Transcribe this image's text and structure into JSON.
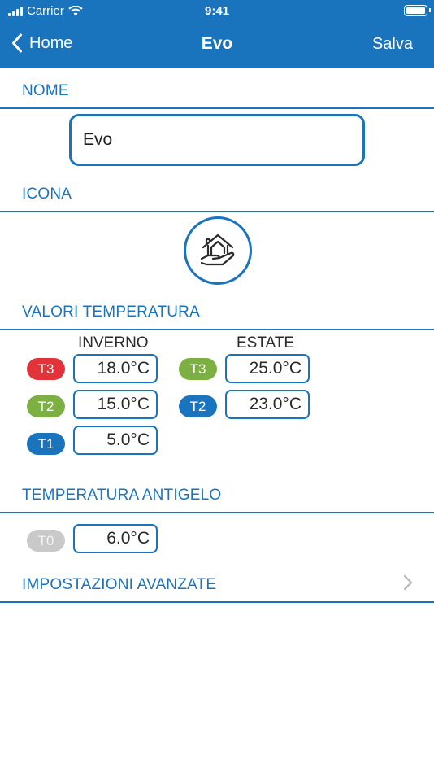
{
  "status_bar": {
    "carrier": "Carrier",
    "time": "9:41"
  },
  "nav": {
    "back_label": "Home",
    "title": "Evo",
    "save_label": "Salva"
  },
  "sections": {
    "name": {
      "header": "NOME",
      "value": "Evo"
    },
    "icon": {
      "header": "ICONA",
      "selected_icon": "house-hand-icon"
    },
    "temperatures": {
      "header": "VALORI TEMPERATURA",
      "winter": {
        "heading": "INVERNO",
        "rows": [
          {
            "tag": "T3",
            "color": "#e2333a",
            "value": "18.0°C"
          },
          {
            "tag": "T2",
            "color": "#7db043",
            "value": "15.0°C"
          },
          {
            "tag": "T1",
            "color": "#1a73bd",
            "value": "5.0°C"
          }
        ]
      },
      "summer": {
        "heading": "ESTATE",
        "rows": [
          {
            "tag": "T3",
            "color": "#7db043",
            "value": "25.0°C"
          },
          {
            "tag": "T2",
            "color": "#1a73bd",
            "value": "23.0°C"
          }
        ]
      }
    },
    "antifreeze": {
      "header": "TEMPERATURA ANTIGELO",
      "row": {
        "tag": "T0",
        "color": "#c9c9c9",
        "value": "6.0°C"
      }
    },
    "advanced": {
      "label": "IMPOSTAZIONI AVANZATE"
    }
  },
  "colors": {
    "accent": "#1a73bd",
    "background": "#ffffff"
  }
}
